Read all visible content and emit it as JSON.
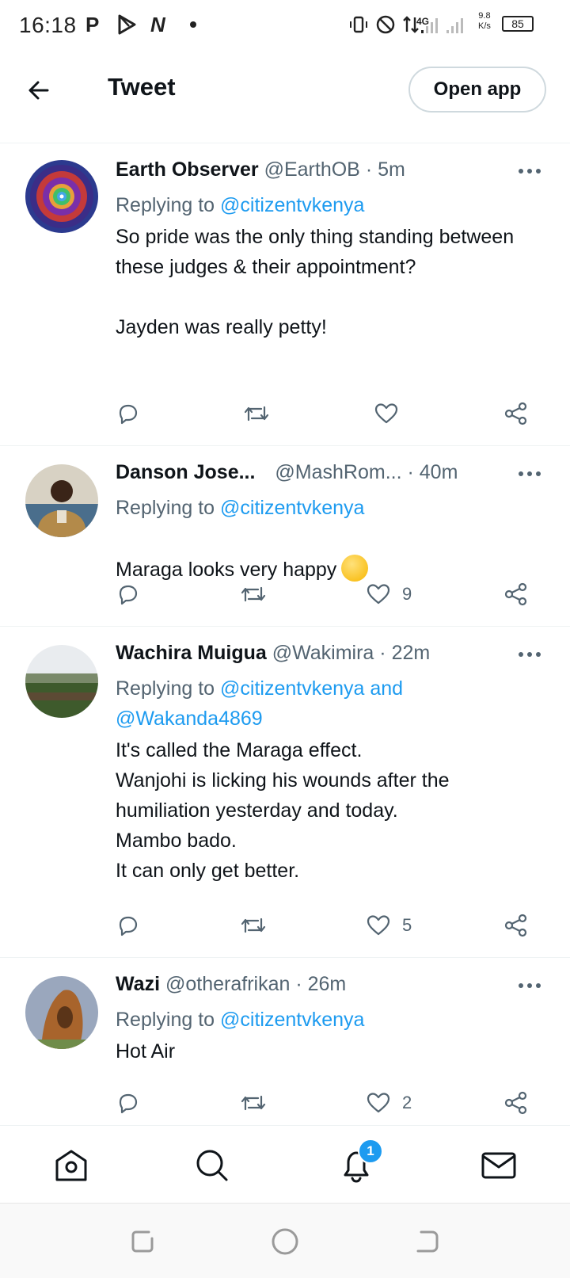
{
  "status_bar": {
    "time": "16:18",
    "network_speed_top": "9.8",
    "network_speed_bottom": "K/s",
    "battery": "85",
    "network_label": "4G"
  },
  "header": {
    "title": "Tweet",
    "open_app_label": "Open app"
  },
  "colors": {
    "accent": "#1d9bf0",
    "text": "#0f1419",
    "muted": "#536471"
  },
  "tweets": [
    {
      "name": "Earth Observer",
      "handle": "@EarthOB",
      "sep": "·",
      "time": "5m",
      "replying_prefix": "Replying to",
      "replying_to": "@citizentvkenya",
      "body": "So pride was the only thing standing between these judges & their appointment?\n\nJayden was really petty!",
      "likes": ""
    },
    {
      "name": "Danson Jose...",
      "handle": "@MashRom...",
      "sep": "·",
      "time": "40m",
      "replying_prefix": "Replying to",
      "replying_to": "@citizentvkenya",
      "body": "Maraga looks very happy",
      "emoji": "smiling-face-emoji",
      "likes": "9"
    },
    {
      "name": "Wachira Muigua",
      "handle": "@Wakimira",
      "sep": "·",
      "time": "22m",
      "replying_prefix": "Replying to",
      "replying_to": "@citizentvkenya and",
      "replying_to_2": "@Wakanda4869",
      "body": "It's called the Maraga effect.\nWanjohi is licking his wounds after the humiliation yesterday and today.\nMambo bado.\nIt can only get better.",
      "likes": "5"
    },
    {
      "name": "Wazi",
      "handle": "@otherafrikan",
      "sep": "·",
      "time": "26m",
      "replying_prefix": "Replying to",
      "replying_to": "@citizentvkenya",
      "body": "Hot Air",
      "likes": "2"
    }
  ],
  "bottom_nav": {
    "items": [
      "home-icon",
      "search-icon",
      "notifications-icon",
      "messages-icon"
    ],
    "notification_badge": "1"
  }
}
